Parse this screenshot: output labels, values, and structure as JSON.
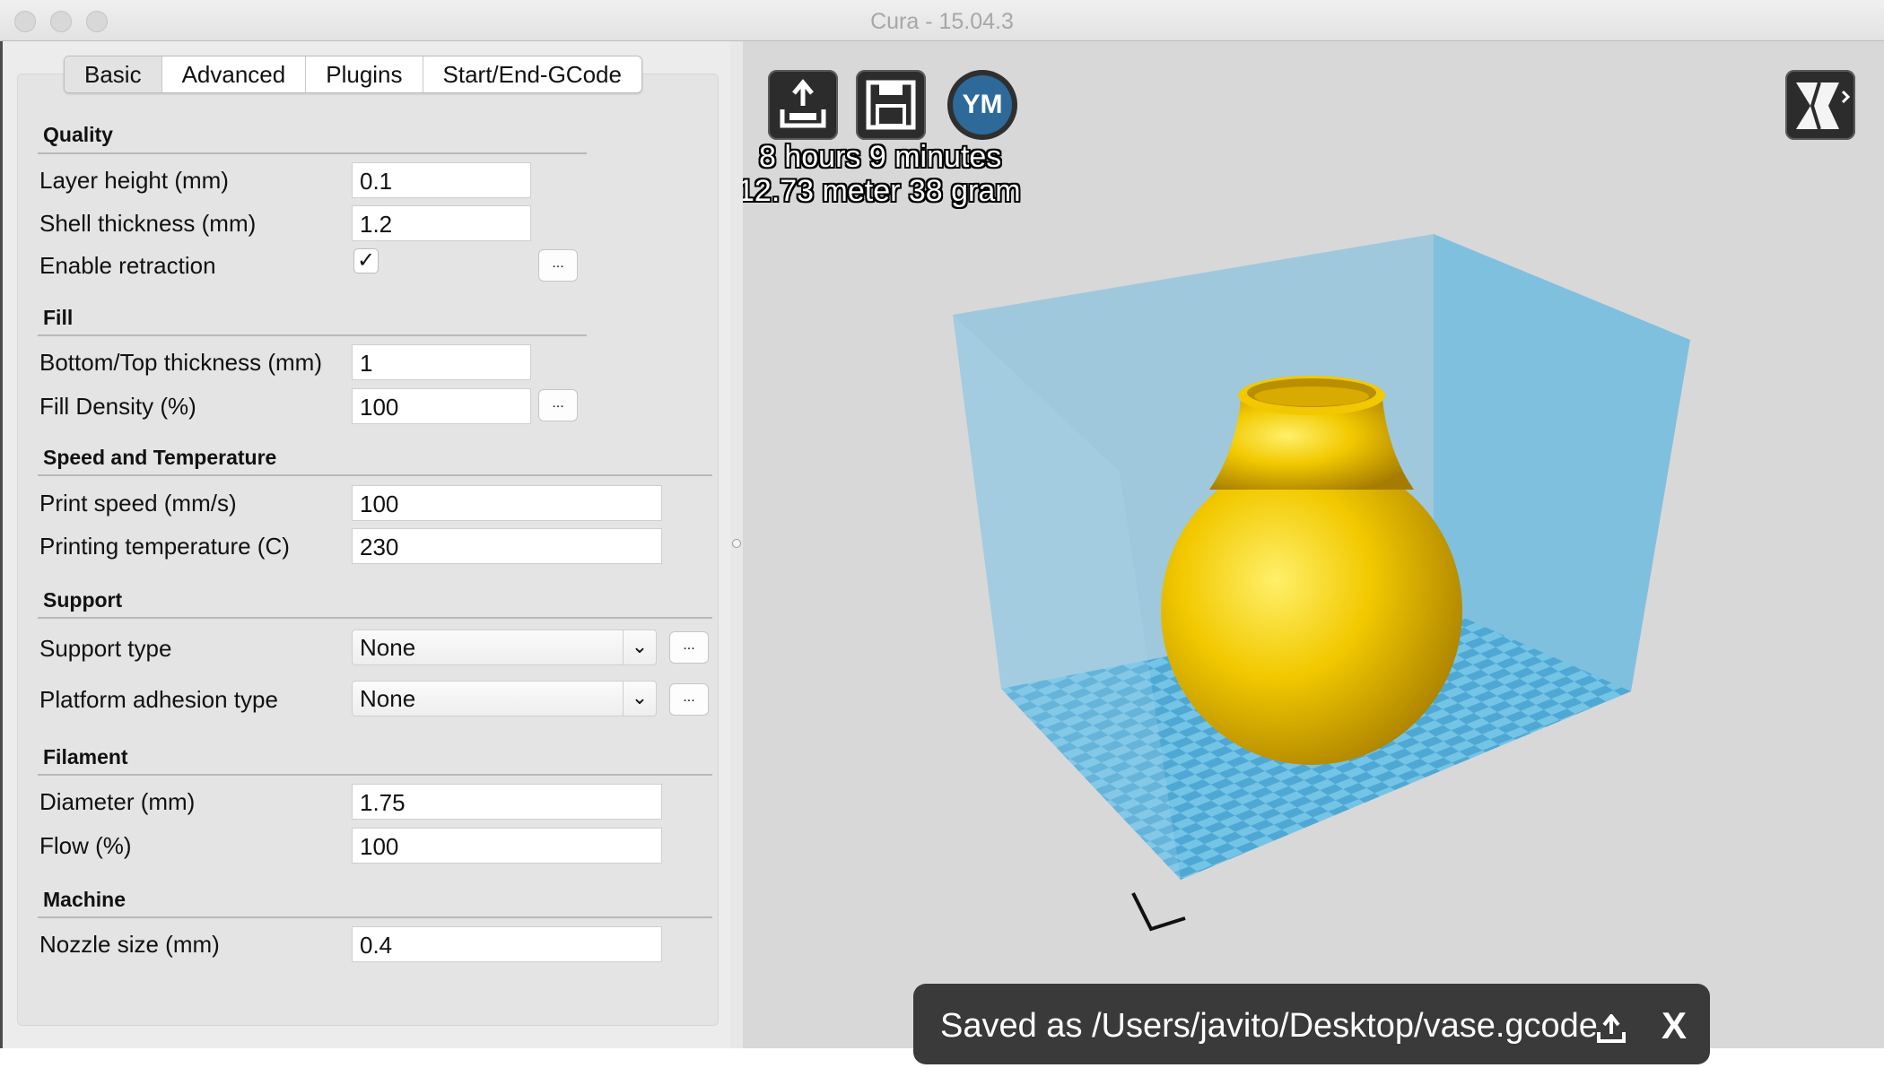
{
  "window": {
    "title": "Cura - 15.04.3"
  },
  "tabs": [
    "Basic",
    "Advanced",
    "Plugins",
    "Start/End-GCode"
  ],
  "sections": {
    "quality": "Quality",
    "fill": "Fill",
    "speed": "Speed and Temperature",
    "support": "Support",
    "filament": "Filament",
    "machine": "Machine"
  },
  "quality": {
    "layer_height_label": "Layer height (mm)",
    "layer_height": "0.1",
    "shell_label": "Shell thickness (mm)",
    "shell": "1.2",
    "retraction_label": "Enable retraction",
    "retraction_check": "✓"
  },
  "fill": {
    "bottom_top_label": "Bottom/Top thickness (mm)",
    "bottom_top": "1",
    "density_label": "Fill Density (%)",
    "density": "100"
  },
  "speed": {
    "print_speed_label": "Print speed (mm/s)",
    "print_speed": "100",
    "temp_label": "Printing temperature (C)",
    "temp": "230"
  },
  "support": {
    "type_label": "Support type",
    "type": "None",
    "adhesion_label": "Platform adhesion type",
    "adhesion": "None"
  },
  "filament": {
    "diameter_label": "Diameter (mm)",
    "diameter": "1.75",
    "flow_label": "Flow (%)",
    "flow": "100"
  },
  "machine": {
    "nozzle_label": "Nozzle size (mm)",
    "nozzle": "0.4"
  },
  "dots_label": "...",
  "view": {
    "ym_label": "YM",
    "print_time": "8 hours 9 minutes",
    "material": "12.73 meter 38 gram",
    "toast": "Saved as /Users/javito/Desktop/vase.gcode",
    "toast_close": "X"
  },
  "colors": {
    "object": "#f2c200",
    "build_volume": "#7ec3e3",
    "platform": "#5fb4dc"
  }
}
